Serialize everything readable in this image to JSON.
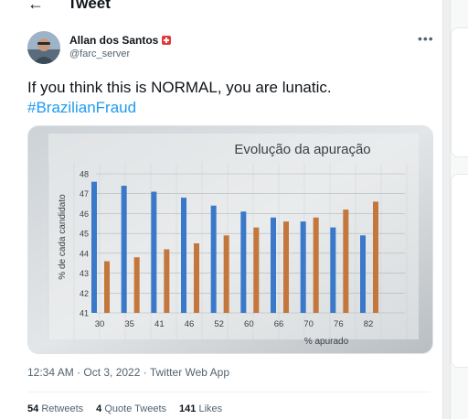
{
  "header": {
    "title": "Tweet",
    "back_icon": "arrow-left-icon"
  },
  "author": {
    "name": "Allan dos Santos",
    "handle": "@farc_server",
    "badge_icon": "swiss-flag-icon"
  },
  "tweet": {
    "text": "If you think this is NORMAL, you are lunatic.",
    "hashtag": "#BrazilianFraud",
    "timestamp": "12:34 AM · Oct 3, 2022 · Twitter Web App"
  },
  "stats": {
    "retweets_count": "54",
    "retweets_label": "Retweets",
    "quotes_count": "4",
    "quotes_label": "Quote Tweets",
    "likes_count": "141",
    "likes_label": "Likes"
  },
  "chart_data": {
    "type": "bar",
    "title": "Evolução da apuração",
    "xlabel": "% apurado",
    "ylabel": "% de cada candidato",
    "ylim": [
      41,
      48
    ],
    "yticks": [
      41,
      42,
      43,
      44,
      45,
      46,
      47,
      48
    ],
    "categories": [
      "30",
      "35",
      "41",
      "46",
      "52",
      "60",
      "66",
      "70",
      "76",
      "82"
    ],
    "series": [
      {
        "color": "#3a78c9",
        "values": [
          47.6,
          47.4,
          47.1,
          46.8,
          46.4,
          46.1,
          45.8,
          45.6,
          45.3,
          44.9
        ]
      },
      {
        "color": "#c4773c",
        "values": [
          43.6,
          43.8,
          44.2,
          44.5,
          44.9,
          45.3,
          45.6,
          45.8,
          46.2,
          46.6
        ]
      }
    ]
  }
}
